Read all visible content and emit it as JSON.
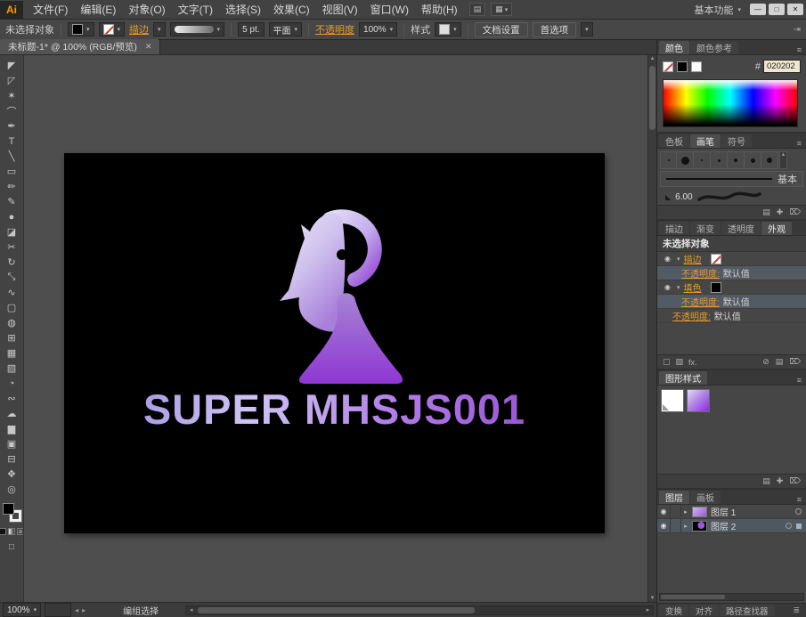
{
  "titlebar": {
    "logo": "Ai",
    "workspace": "基本功能"
  },
  "menus": [
    "文件(F)",
    "编辑(E)",
    "对象(O)",
    "文字(T)",
    "选择(S)",
    "效果(C)",
    "视图(V)",
    "窗口(W)",
    "帮助(H)"
  ],
  "control_bar": {
    "no_selection": "未选择对象",
    "stroke_link": "描边",
    "stroke_weight": "5 pt.",
    "profile": "平面",
    "opacity_link": "不透明度",
    "opacity_value": "100%",
    "style_label": "样式",
    "doc_setup_button": "文档设置",
    "preferences_button": "首选项"
  },
  "document_tab": {
    "title": "未标题-1* @ 100% (RGB/预览)"
  },
  "toolbar": {
    "tools": [
      {
        "name": "selection-tool-icon",
        "glyph": "◤"
      },
      {
        "name": "direct-selection-tool-icon",
        "glyph": "◸"
      },
      {
        "name": "magic-wand-tool-icon",
        "glyph": "✶"
      },
      {
        "name": "lasso-tool-icon",
        "glyph": "⌒"
      },
      {
        "name": "pen-tool-icon",
        "glyph": "✒"
      },
      {
        "name": "type-tool-icon",
        "glyph": "T"
      },
      {
        "name": "line-tool-icon",
        "glyph": "╲"
      },
      {
        "name": "rectangle-tool-icon",
        "glyph": "▭"
      },
      {
        "name": "paintbrush-tool-icon",
        "glyph": "✏"
      },
      {
        "name": "pencil-tool-icon",
        "glyph": "✎"
      },
      {
        "name": "blob-brush-tool-icon",
        "glyph": "●"
      },
      {
        "name": "eraser-tool-icon",
        "glyph": "◪"
      },
      {
        "name": "scissors-tool-icon",
        "glyph": "✂"
      },
      {
        "name": "rotate-tool-icon",
        "glyph": "↻"
      },
      {
        "name": "scale-tool-icon",
        "glyph": "⤡"
      },
      {
        "name": "width-tool-icon",
        "glyph": "∿"
      },
      {
        "name": "free-transform-tool-icon",
        "glyph": "▢"
      },
      {
        "name": "shape-builder-tool-icon",
        "glyph": "◍"
      },
      {
        "name": "perspective-grid-tool-icon",
        "glyph": "⊞"
      },
      {
        "name": "mesh-tool-icon",
        "glyph": "▦"
      },
      {
        "name": "gradient-tool-icon",
        "glyph": "▧"
      },
      {
        "name": "eyedropper-tool-icon",
        "glyph": "◔"
      },
      {
        "name": "blend-tool-icon",
        "glyph": "∾"
      },
      {
        "name": "symbol-sprayer-tool-icon",
        "glyph": "☁"
      },
      {
        "name": "column-graph-tool-icon",
        "glyph": "▆"
      },
      {
        "name": "artboard-tool-icon",
        "glyph": "▣"
      },
      {
        "name": "slice-tool-icon",
        "glyph": "⊟"
      },
      {
        "name": "hand-tool-icon",
        "glyph": "✥"
      },
      {
        "name": "zoom-tool-icon",
        "glyph": "◎"
      }
    ]
  },
  "artboard": {
    "logo_text": "SUPER MHSJS001"
  },
  "panels": {
    "color": {
      "tab_color": "颜色",
      "tab_guide": "颜色参考",
      "hex_label": "#",
      "hex_value": "020202"
    },
    "brushes": {
      "tab_swatches": "色板",
      "tab_brushes": "画笔",
      "tab_symbols": "符号",
      "basic_label": "基本",
      "calligraphic_size": "6.00",
      "dot_sizes": [
        2,
        9,
        2,
        3,
        4,
        5,
        6
      ]
    },
    "appearance": {
      "tab_stroke": "描边",
      "tab_gradient": "渐变",
      "tab_transparency": "透明度",
      "tab_appearance": "外观",
      "no_selection": "未选择对象",
      "stroke_label": "描边",
      "fill_label": "填色",
      "opacity_label": "不透明度:",
      "opacity_value": "默认值"
    },
    "graphic_styles": {
      "tab": "图形样式"
    },
    "layers": {
      "tab_layers": "图层",
      "tab_artboards": "画板",
      "layer1": "图层 1",
      "layer2": "图层 2"
    },
    "dock_tabs": {
      "transform": "变换",
      "align": "对齐",
      "pathfinder": "路径查找器"
    }
  },
  "status_bar": {
    "zoom": "100%",
    "tool_name": "编组选择"
  },
  "icons": {
    "caret_down": "▾",
    "caret_right": "▸",
    "caret_up": "▴",
    "caret_left": "◂",
    "close": "✕",
    "eye": "◉",
    "panel_menu": "≡",
    "workspace_menu": "≣",
    "minimize": "—",
    "maximize": "□",
    "scroll_up": "▲",
    "scroll_down": "▼",
    "new_item": "✚",
    "delete_item": "⌦",
    "none": "⊘",
    "fx": "fx.",
    "swatch_box": "▢",
    "hatch_box": "▧",
    "doc_icon": "▤",
    "grid_icon": "▦",
    "brush_tip": "◣",
    "collapse": "⇥"
  },
  "colors": {
    "accent_orange": "#e59a2a",
    "artboard_bg": "#000000",
    "logo_purple": "#9b59d6",
    "hex_bg": "#020202"
  }
}
